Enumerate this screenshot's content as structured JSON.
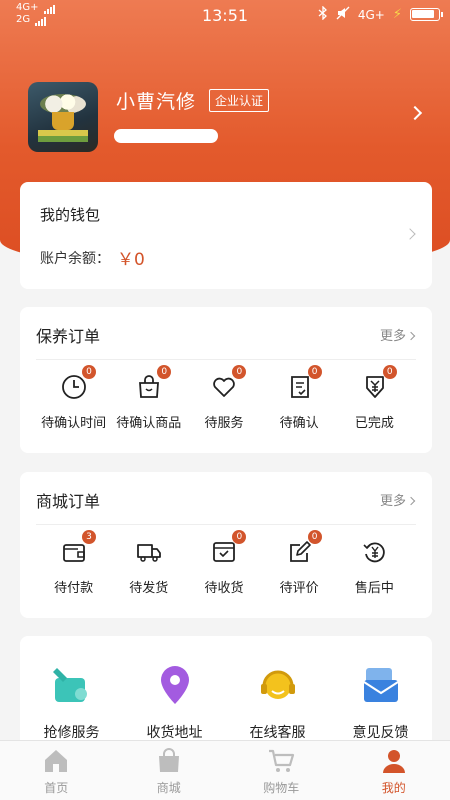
{
  "status_bar": {
    "network_top": "4G+",
    "network_bottom": "2G",
    "time": "13:51",
    "network_right": "4G+"
  },
  "profile": {
    "name": "小曹汽修",
    "badge": "企业认证"
  },
  "wallet": {
    "title": "我的钱包",
    "balance_label": "账户余额：",
    "balance_value": "￥0"
  },
  "maintenance_orders": {
    "title": "保养订单",
    "more": "更多",
    "items": [
      {
        "label": "待确认时间",
        "count": "0",
        "icon": "clock-icon"
      },
      {
        "label": "待确认商品",
        "count": "0",
        "icon": "shopping-bag-icon"
      },
      {
        "label": "待服务",
        "count": "0",
        "icon": "heart-icon"
      },
      {
        "label": "待确认",
        "count": "0",
        "icon": "document-check-icon"
      },
      {
        "label": "已完成",
        "count": "0",
        "icon": "yen-shield-icon"
      }
    ]
  },
  "mall_orders": {
    "title": "商城订单",
    "more": "更多",
    "items": [
      {
        "label": "待付款",
        "count": "3",
        "icon": "wallet-icon"
      },
      {
        "label": "待发货",
        "count": "",
        "icon": "truck-icon"
      },
      {
        "label": "待收货",
        "count": "0",
        "icon": "box-check-icon"
      },
      {
        "label": "待评价",
        "count": "0",
        "icon": "edit-icon"
      },
      {
        "label": "售后中",
        "count": "",
        "icon": "yen-refresh-icon"
      }
    ]
  },
  "services": [
    {
      "label": "抢修服务",
      "icon": "repair-wrench-icon"
    },
    {
      "label": "收货地址",
      "icon": "location-pin-icon"
    },
    {
      "label": "在线客服",
      "icon": "headset-agent-icon"
    },
    {
      "label": "意见反馈",
      "icon": "feedback-mail-icon"
    }
  ],
  "tabbar": [
    {
      "label": "首页",
      "icon": "home-icon"
    },
    {
      "label": "商城",
      "icon": "shop-bag-icon"
    },
    {
      "label": "购物车",
      "icon": "cart-icon"
    },
    {
      "label": "我的",
      "icon": "user-icon"
    }
  ],
  "colors": {
    "accent": "#d3542a",
    "header_top": "#ee7b52",
    "header_bottom": "#dc4d22",
    "badge": "#d2552c"
  }
}
